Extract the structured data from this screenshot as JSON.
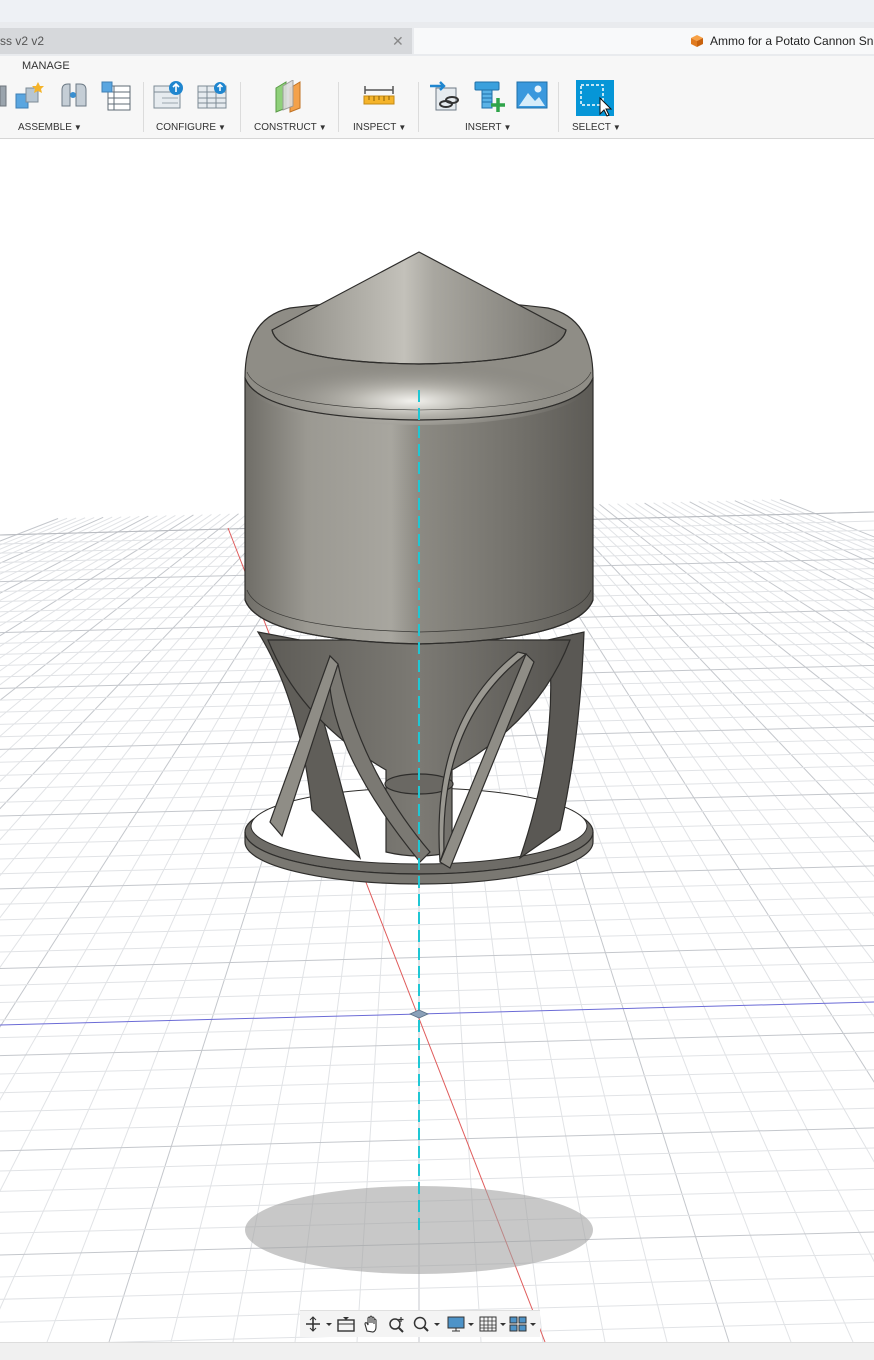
{
  "tabs": [
    {
      "label": "ss v2 v2",
      "active": false
    },
    {
      "label": "Ammo for a Potato Cannon Sn",
      "active": true
    }
  ],
  "ribbon": {
    "manage_label": "MANAGE",
    "groups": [
      {
        "label": "ASSEMBLE"
      },
      {
        "label": "CONFIGURE"
      },
      {
        "label": "CONSTRUCT"
      },
      {
        "label": "INSPECT"
      },
      {
        "label": "INSERT"
      },
      {
        "label": "SELECT"
      }
    ]
  },
  "icons": {
    "close": "close-icon",
    "document": "orange-cube-icon",
    "assemble": [
      "new-component-icon",
      "joint-icon",
      "bill-of-materials-icon"
    ],
    "configure": [
      "configure-icon",
      "configure-table-icon"
    ],
    "construct": [
      "offset-plane-icon"
    ],
    "inspect": [
      "measure-icon"
    ],
    "insert": [
      "insert-derive-icon",
      "insert-mcmaster-icon",
      "insert-canvas-icon"
    ],
    "select": [
      "window-select-icon"
    ],
    "navbar": [
      "orbit-icon",
      "look-at-icon",
      "pan-icon",
      "zoom-icon",
      "fit-icon",
      "display-settings-icon",
      "grid-icon",
      "viewports-icon"
    ]
  },
  "colors": {
    "accent": "#0696d7",
    "model_body": "#8e8c85",
    "grid": "#d7d9dc",
    "axis_red": "#e05c5c",
    "axis_blue": "#6b6bd6",
    "axis_cyan": "#1fc7d4"
  }
}
